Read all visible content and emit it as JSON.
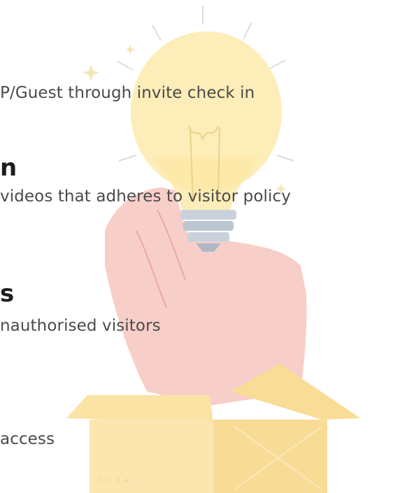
{
  "features": [
    {
      "heading": "",
      "description": "P/Guest through invite check in"
    },
    {
      "heading": "n",
      "description": "videos that adheres to visitor policy"
    },
    {
      "heading": "s",
      "description": "nauthorised visitors"
    },
    {
      "heading": "",
      "description": "access"
    }
  ],
  "illustration": {
    "name": "lightbulb-in-hand-from-box",
    "box_label": "III ⊻ ♟",
    "colors": {
      "bulb": "#fde8a0",
      "bulb_base": "#c9d2dc",
      "hand": "#f7c6c0",
      "box": "#fbe3a6",
      "box_dark": "#f7d98e",
      "rays": "#c8c8c8"
    }
  }
}
